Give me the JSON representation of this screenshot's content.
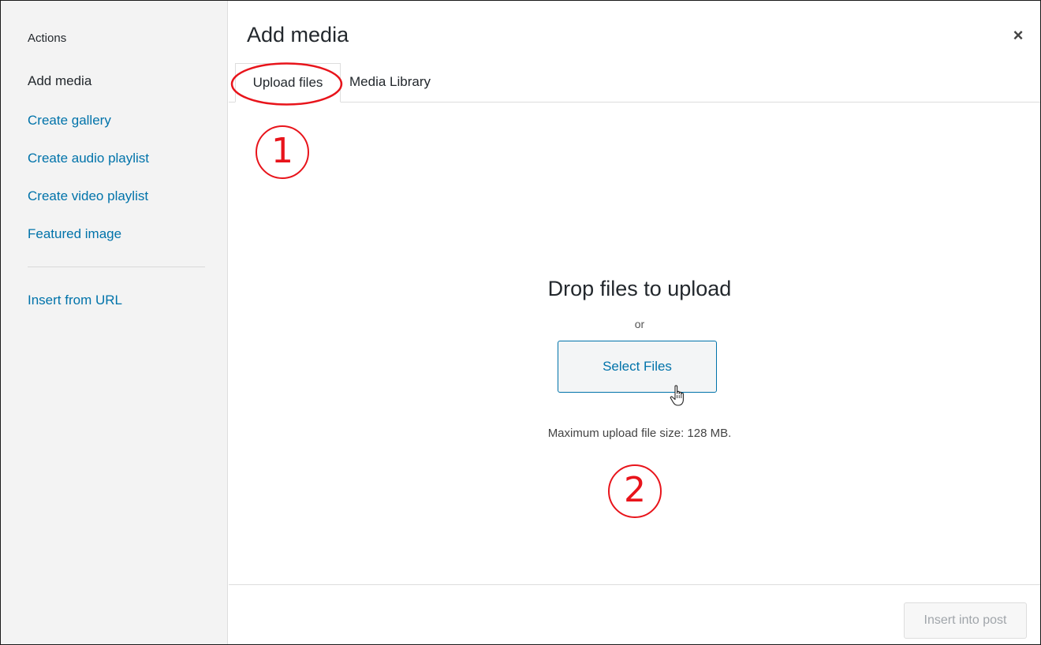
{
  "sidebar": {
    "heading": "Actions",
    "items": [
      {
        "label": "Add media"
      },
      {
        "label": "Create gallery"
      },
      {
        "label": "Create audio playlist"
      },
      {
        "label": "Create video playlist"
      },
      {
        "label": "Featured image"
      }
    ],
    "url_item": "Insert from URL"
  },
  "header": {
    "title": "Add media",
    "close_icon": "×"
  },
  "tabs": [
    {
      "label": "Upload files",
      "active": true
    },
    {
      "label": "Media Library",
      "active": false
    }
  ],
  "upload": {
    "drop_text": "Drop files to upload",
    "or_text": "or",
    "button_label": "Select Files",
    "max_size_text": "Maximum upload file size: 128 MB."
  },
  "footer": {
    "insert_label": "Insert into post"
  },
  "annotations": {
    "step1": "1",
    "step2": "2",
    "color": "#e8141b"
  },
  "colors": {
    "link": "#0073aa",
    "sidebar_bg": "#f3f3f3",
    "text": "#23282d"
  }
}
